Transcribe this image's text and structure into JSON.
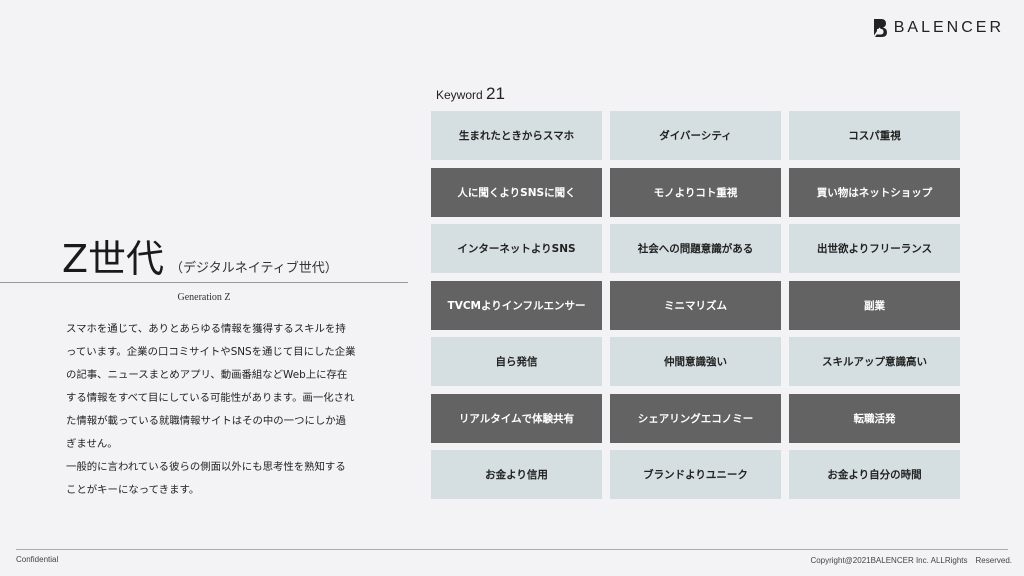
{
  "logo": {
    "text": "BALENCER",
    "icon": "balencer-b-icon"
  },
  "title": {
    "main": "Z世代",
    "sub": "（デジタルネイティブ世代）"
  },
  "section_label": "Generation Z",
  "body_paragraphs": [
    "スマホを通じて、ありとあらゆる情報を獲得するスキルを持っています。企業の口コミサイトやSNSを通じて目にした企業の記事、ニュースまとめアプリ、動画番組などWeb上に存在する情報をすべて目にしている可能性があります。画一化された情報が載っている就職情報サイトはその中の一つにしか過ぎません。",
    "一般的に言われている彼らの側面以外にも思考性を熟知することがキーになってきます。"
  ],
  "keyword": {
    "label": "Keyword",
    "number": "21"
  },
  "keywords": [
    {
      "text": "生まれたときからスマホ",
      "style": "light"
    },
    {
      "text": "ダイバーシティ",
      "style": "light"
    },
    {
      "text": "コスパ重視",
      "style": "light"
    },
    {
      "text": "人に聞くよりSNSに聞く",
      "style": "dark"
    },
    {
      "text": "モノよりコト重視",
      "style": "dark"
    },
    {
      "text": "買い物はネットショップ",
      "style": "dark"
    },
    {
      "text": "インターネットよりSNS",
      "style": "light"
    },
    {
      "text": "社会への問題意識がある",
      "style": "light"
    },
    {
      "text": "出世欲よりフリーランス",
      "style": "light"
    },
    {
      "text": "TVCMよりインフルエンサー",
      "style": "dark"
    },
    {
      "text": "ミニマリズム",
      "style": "dark"
    },
    {
      "text": "副業",
      "style": "dark"
    },
    {
      "text": "自ら発信",
      "style": "light"
    },
    {
      "text": "仲間意識強い",
      "style": "light"
    },
    {
      "text": "スキルアップ意識高い",
      "style": "light"
    },
    {
      "text": "リアルタイムで体験共有",
      "style": "dark"
    },
    {
      "text": "シェアリングエコノミー",
      "style": "dark"
    },
    {
      "text": "転職活発",
      "style": "dark"
    },
    {
      "text": "お金より信用",
      "style": "light"
    },
    {
      "text": "ブランドよりユニーク",
      "style": "light"
    },
    {
      "text": "お金より自分の時間",
      "style": "light"
    }
  ],
  "footer": {
    "left": "Confidential",
    "right": "Copyright@2021BALENCER Inc. ALLRights　Reserved."
  },
  "colors": {
    "light_cell": "#d5dfe1",
    "dark_cell": "#636363",
    "background": "#f3f3f5"
  }
}
